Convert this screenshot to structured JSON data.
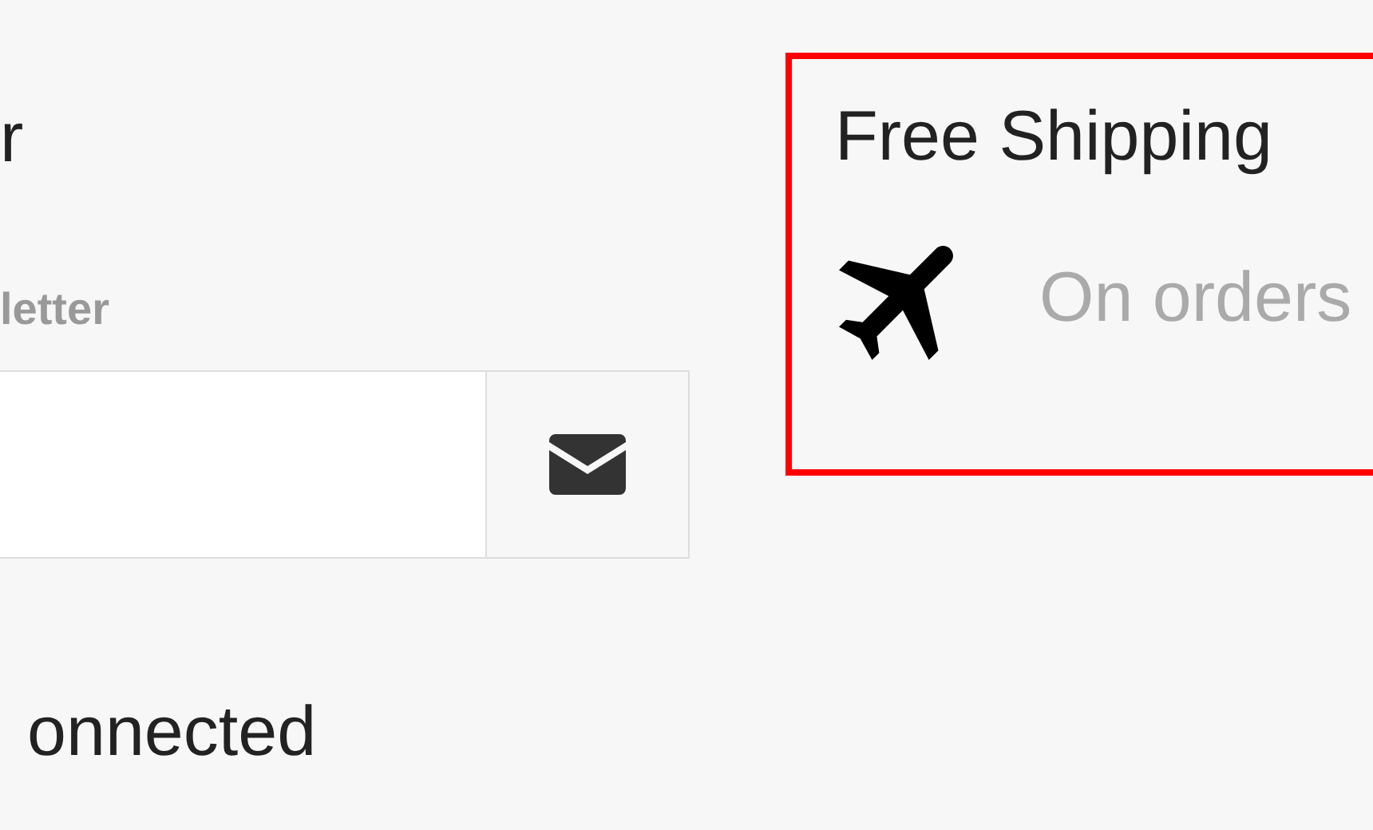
{
  "newsletter": {
    "heading": "r",
    "label": "letter"
  },
  "social": {
    "heading": "onnected"
  },
  "feature": {
    "title": "Free Shipping",
    "text": "On orders"
  }
}
